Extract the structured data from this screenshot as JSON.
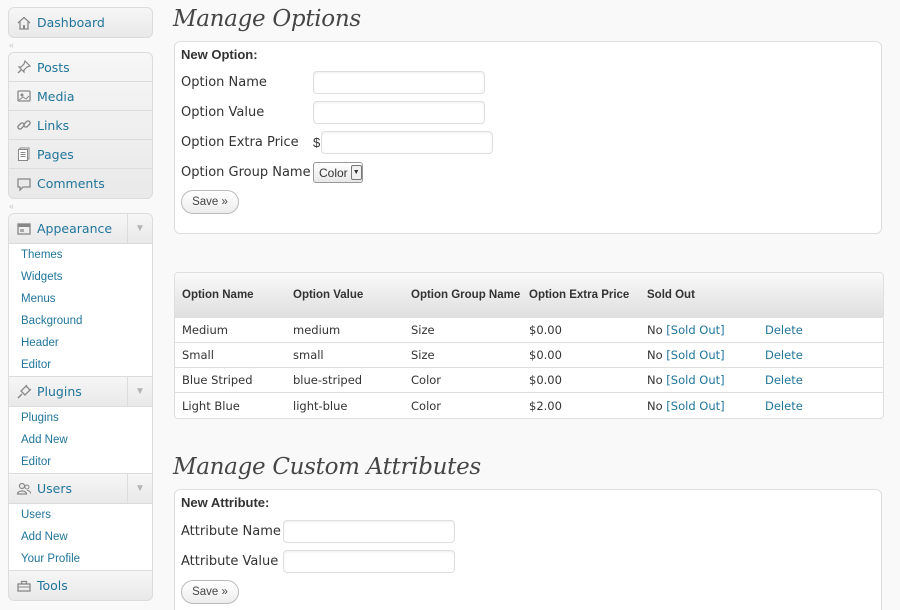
{
  "sidebar": {
    "dashboard": "Dashboard",
    "posts": "Posts",
    "media": "Media",
    "links": "Links",
    "pages": "Pages",
    "comments": "Comments",
    "appearance": {
      "label": "Appearance",
      "items": [
        "Themes",
        "Widgets",
        "Menus",
        "Background",
        "Header",
        "Editor"
      ]
    },
    "plugins": {
      "label": "Plugins",
      "items": [
        "Plugins",
        "Add New",
        "Editor"
      ]
    },
    "users": {
      "label": "Users",
      "items": [
        "Users",
        "Add New",
        "Your Profile"
      ]
    },
    "tools": "Tools"
  },
  "options": {
    "heading": "Manage Options",
    "form_title": "New Option:",
    "name_label": "Option Name",
    "value_label": "Option Value",
    "price_label": "Option Extra Price",
    "currency": "$",
    "group_label": "Option Group Name",
    "group_selected": "Color",
    "save_label": "Save »"
  },
  "table": {
    "headers": [
      "Option Name",
      "Option Value",
      "Option Group Name",
      "Option Extra Price",
      "Sold Out"
    ],
    "rows": [
      {
        "name": "Medium",
        "value": "medium",
        "group": "Size",
        "price": "$0.00",
        "sold": "No",
        "sold_link": "[Sold Out]",
        "delete": "Delete"
      },
      {
        "name": "Small",
        "value": "small",
        "group": "Size",
        "price": "$0.00",
        "sold": "No",
        "sold_link": "[Sold Out]",
        "delete": "Delete"
      },
      {
        "name": "Blue Striped",
        "value": "blue-striped",
        "group": "Color",
        "price": "$0.00",
        "sold": "No",
        "sold_link": "[Sold Out]",
        "delete": "Delete"
      },
      {
        "name": "Light Blue",
        "value": "light-blue",
        "group": "Color",
        "price": "$2.00",
        "sold": "No",
        "sold_link": "[Sold Out]",
        "delete": "Delete"
      }
    ]
  },
  "attributes": {
    "heading": "Manage Custom Attributes",
    "form_title": "New Attribute:",
    "name_label": "Attribute Name",
    "value_label": "Attribute Value",
    "save_label": "Save »"
  },
  "colors": {
    "link": "#21759b",
    "heading": "#464646"
  }
}
